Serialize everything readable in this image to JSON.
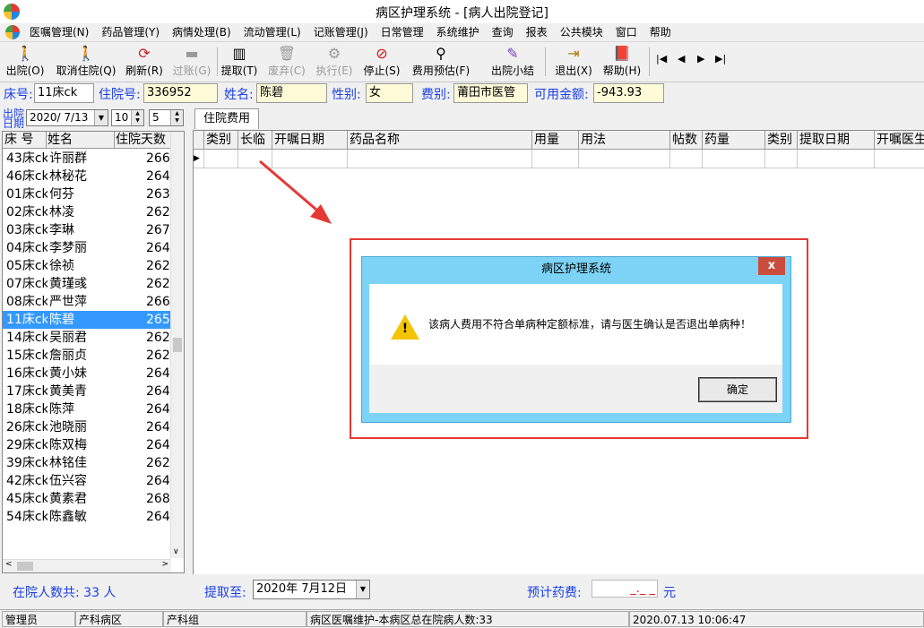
{
  "window": {
    "title": "病区护理系统 - [病人出院登记]"
  },
  "menu": [
    "医嘱管理(N)",
    "药品管理(Y)",
    "病情处理(B)",
    "流动管理(L)",
    "记账管理(J)",
    "日常管理",
    "系统维护",
    "查询",
    "报表",
    "公共模块",
    "窗口",
    "帮助"
  ],
  "toolbar": {
    "discharge": "出院(O)",
    "cancel_discharge": "取消住院(Q)",
    "refresh": "刷新(R)",
    "charge_off": "过账(G)",
    "fetch": "提取(T)",
    "abandon": "废弃(C)",
    "execute": "执行(E)",
    "stop": "停止(S)",
    "fee_estimate": "费用预估(F)",
    "discharge_summary": "出院小结",
    "exit": "退出(X)",
    "help": "帮助(H)"
  },
  "patient": {
    "bed_label": "床号:",
    "bed": "11床ck",
    "admission_label": "住院号:",
    "admission": "336952",
    "name_label": "姓名:",
    "name": "陈碧",
    "gender_label": "性别:",
    "gender": "女",
    "fee_type_label": "费别:",
    "fee_type": "莆田市医管",
    "balance_label": "可用金额:",
    "balance": "-943.93"
  },
  "discharge_date": {
    "label": "出院日期",
    "date": "2020/ 7/13",
    "hour": "10",
    "minute": "5"
  },
  "patient_list": {
    "headers": [
      "床 号",
      "姓名",
      "住院天数"
    ],
    "rows": [
      {
        "bed": "43床ck",
        "name": "许丽群",
        "days": "266"
      },
      {
        "bed": "46床ck",
        "name": "林秘花",
        "days": "264"
      },
      {
        "bed": "01床ck",
        "name": "何芬",
        "days": "263"
      },
      {
        "bed": "02床ck",
        "name": "林凌",
        "days": "262"
      },
      {
        "bed": "03床ck",
        "name": "李琳",
        "days": "267"
      },
      {
        "bed": "04床ck",
        "name": "李梦丽",
        "days": "264"
      },
      {
        "bed": "05床ck",
        "name": "徐祯",
        "days": "262"
      },
      {
        "bed": "07床ck",
        "name": "黄瑾彧",
        "days": "262"
      },
      {
        "bed": "08床ck",
        "name": "严世萍",
        "days": "266"
      },
      {
        "bed": "11床ck",
        "name": "陈碧",
        "days": "265"
      },
      {
        "bed": "14床ck",
        "name": "吴丽君",
        "days": "262"
      },
      {
        "bed": "15床ck",
        "name": "詹丽贞",
        "days": "262"
      },
      {
        "bed": "16床ck",
        "name": "黄小妹",
        "days": "264"
      },
      {
        "bed": "17床ck",
        "name": "黄美青",
        "days": "264"
      },
      {
        "bed": "18床ck",
        "name": "陈萍",
        "days": "264"
      },
      {
        "bed": "26床ck",
        "name": "池晓丽",
        "days": "264"
      },
      {
        "bed": "29床ck",
        "name": "陈双梅",
        "days": "264"
      },
      {
        "bed": "39床ck",
        "name": "林铭佳",
        "days": "262"
      },
      {
        "bed": "42床ck",
        "name": "伍兴容",
        "days": "264"
      },
      {
        "bed": "45床ck",
        "name": "黄素君",
        "days": "268"
      },
      {
        "bed": "54床ck",
        "name": "陈鑫敏",
        "days": "264"
      }
    ],
    "selected_index": 9
  },
  "fees_tab": {
    "tab_label": "住院费用",
    "headers": [
      "类别",
      "长临",
      "开嘱日期",
      "药品名称",
      "用量",
      "用法",
      "帖数",
      "药量",
      "类别",
      "提取日期",
      "开嘱医生"
    ]
  },
  "dialog": {
    "title": "病区护理系统",
    "close": "x",
    "message": "该病人费用不符合单病种定额标准，请与医生确认是否退出单病种！",
    "ok": "确定"
  },
  "bottom": {
    "inpatient_count": "在院人数共: 33 人",
    "fetch_label": "提取至:",
    "fetch_date": "2020年 7月12日",
    "estimate_label": "预计药费:",
    "estimate_value": "_._ _",
    "estimate_unit": "元"
  },
  "status": [
    "管理员",
    "产科病区",
    "产科组",
    "病区医嘱维护-本病区总在院病人数:33",
    "2020.07.13 10:06:47"
  ],
  "colors": {
    "label_blue": "#1a3ee8",
    "selection": "#3399ff",
    "dialog_frame": "#7dd3f5",
    "highlight_red": "#e53935",
    "field_bg": "#fffbd9"
  }
}
